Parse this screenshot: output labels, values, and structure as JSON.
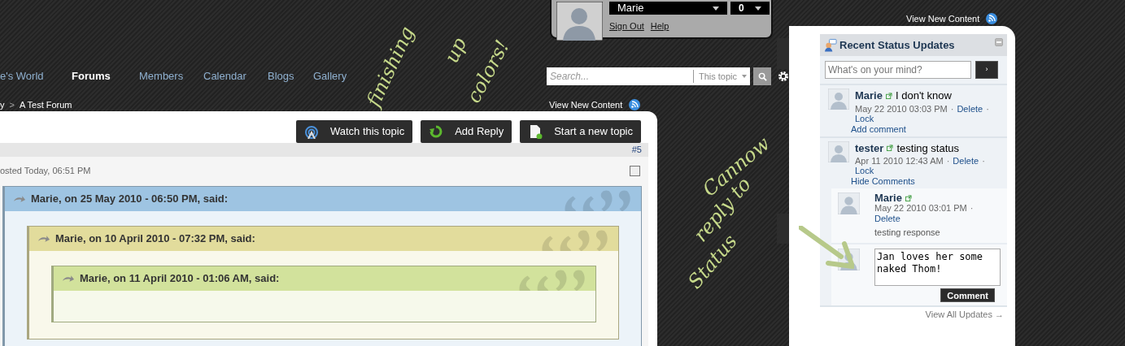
{
  "user_box": {
    "name": "Marie",
    "count": "0",
    "links": [
      "Sign Out",
      "Help"
    ]
  },
  "top_link": {
    "label": "View New Content"
  },
  "nav": [
    {
      "label": "e's World",
      "selected": false
    },
    {
      "label": "Forums",
      "selected": true
    },
    {
      "label": "Members",
      "selected": false
    },
    {
      "label": "Calendar",
      "selected": false
    },
    {
      "label": "Blogs",
      "selected": false
    },
    {
      "label": "Gallery",
      "selected": false
    }
  ],
  "search": {
    "placeholder": "Search...",
    "scope": "This topic"
  },
  "breadcrumb": [
    "y",
    ">",
    "A Test Forum"
  ],
  "view_new_content": {
    "label": "View New Content"
  },
  "topic_buttons": [
    {
      "label": "Watch this topic",
      "kind": "watch"
    },
    {
      "label": "Add Reply",
      "kind": "reply"
    },
    {
      "label": "Start a new topic",
      "kind": "new"
    }
  ],
  "post": {
    "number": "#5",
    "posted": "osted Today, 06:51 PM",
    "checked": false,
    "quote": {
      "header": "Marie, on 25 May 2010 - 06:50 PM, said:",
      "color": "#9ec4e2",
      "children": [
        {
          "header": "Marie, on 10 April 2010 - 07:32 PM, said:",
          "color": "#e2dc9c",
          "children": [
            {
              "header": "Marie, on 11 April 2010 - 01:06 AM, said:",
              "color": "#d2e29c"
            }
          ]
        }
      ]
    }
  },
  "status_panel": {
    "title": "Recent Status Updates",
    "placeholder": "What's on your mind?",
    "submit": "›",
    "updates": [
      {
        "author": "Marie",
        "text": "I don't know",
        "meta": [
          {
            "kind": "date",
            "text": "May 22 2010 03:03 PM"
          },
          {
            "kind": "sep",
            "text": "·"
          },
          {
            "kind": "link",
            "text": "Delete"
          },
          {
            "kind": "sep",
            "text": "·"
          },
          {
            "kind": "link",
            "text": "Lock"
          }
        ],
        "action": "Add comment"
      },
      {
        "author": "tester",
        "text": "testing status",
        "meta": [
          {
            "kind": "date",
            "text": "Apr 11 2010 12:43 AM"
          },
          {
            "kind": "sep",
            "text": "·"
          },
          {
            "kind": "link",
            "text": "Delete"
          },
          {
            "kind": "sep",
            "text": "·"
          },
          {
            "kind": "link",
            "text": "Lock"
          }
        ],
        "action": "Hide Comments",
        "comments": [
          {
            "author": "Marie",
            "meta": [
              {
                "kind": "date",
                "text": "May 22 2010 03:01 PM"
              },
              {
                "kind": "sep",
                "text": "·"
              },
              {
                "kind": "link",
                "text": "Delete"
              }
            ],
            "text": "testing response"
          }
        ],
        "reply": {
          "value": "Jan loves her some naked Thom!",
          "button": "Comment"
        }
      }
    ],
    "footer_link": "View All Updates →"
  },
  "annotations": [
    {
      "lines": [
        "finishing",
        "up",
        "colors!"
      ]
    },
    {
      "lines": [
        "Cannow",
        "reply to",
        "Status"
      ]
    }
  ]
}
